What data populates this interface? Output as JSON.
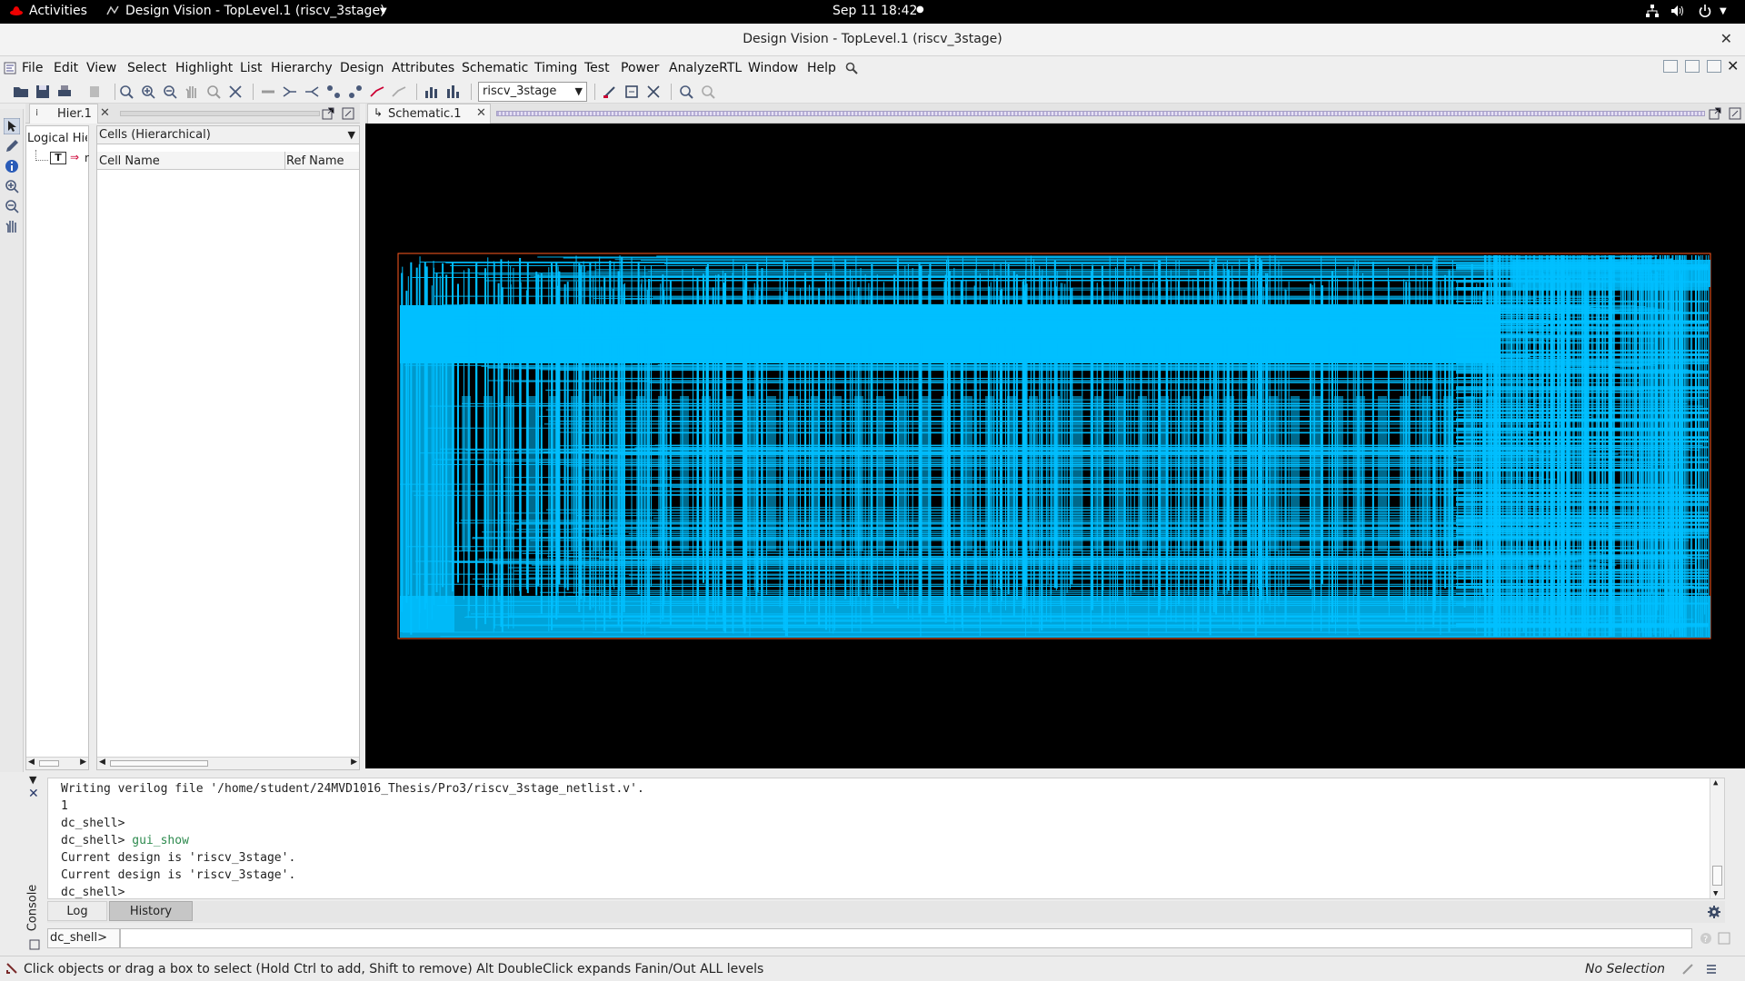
{
  "topbar": {
    "activities": "Activities",
    "app_title": "Design Vision - TopLevel.1 (riscv_3stage)",
    "clock": "Sep 11  18:42"
  },
  "window": {
    "title": "Design Vision - TopLevel.1 (riscv_3stage)"
  },
  "menubar": {
    "items": [
      "File",
      "Edit",
      "View",
      "Select",
      "Highlight",
      "List",
      "Hierarchy",
      "Design",
      "Attributes",
      "Schematic",
      "Timing",
      "Test",
      "Power",
      "AnalyzeRTL",
      "Window",
      "Help"
    ]
  },
  "toolbar": {
    "design_selected": "riscv_3stage"
  },
  "hier_panel": {
    "tab_label": "Hier.1",
    "logical_label": "Logical Hie",
    "tree_root_glyph": "T",
    "tree_root_name": "r",
    "cells_dropdown": "Cells (Hierarchical)",
    "columns": [
      "Cell Name",
      "Ref Name"
    ]
  },
  "schematic_panel": {
    "tab_label": "Schematic.1",
    "wire_color": "#00bfff",
    "border_color": "#ff5a1f",
    "background": "#000000"
  },
  "console": {
    "side_label": "Console",
    "lines": [
      {
        "text": "Writing verilog file '/home/student/24MVD1016_Thesis/Pro3/riscv_3stage_netlist.v'."
      },
      {
        "text": "1"
      },
      {
        "text": "dc_shell>"
      },
      {
        "prompt": "dc_shell> ",
        "cmd": "gui_show"
      },
      {
        "text": "Current design is 'riscv_3stage'."
      },
      {
        "text": "Current design is 'riscv_3stage'."
      },
      {
        "text": "dc_shell>"
      }
    ],
    "tabs": [
      "Log",
      "History"
    ],
    "prompt_label": "dc_shell>",
    "input_value": ""
  },
  "statusbar": {
    "message": "Click objects or drag a box to select (Hold Ctrl to add, Shift to remove) Alt DoubleClick expands Fanin/Out ALL levels",
    "selection": "No Selection"
  }
}
